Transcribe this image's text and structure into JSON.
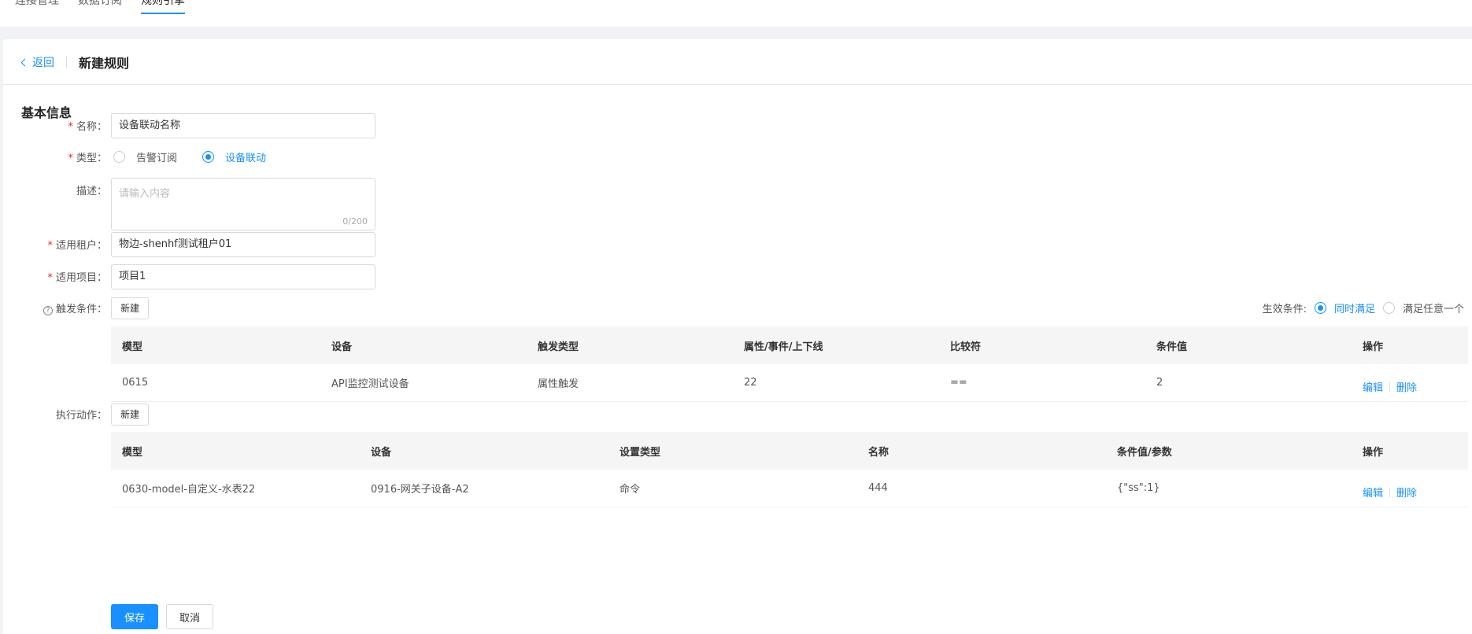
{
  "nav": {
    "tabs": [
      {
        "label": "连接管理",
        "active": false
      },
      {
        "label": "数据订阅",
        "active": false
      },
      {
        "label": "规则引擎",
        "active": true
      }
    ]
  },
  "header": {
    "back_label": "返回",
    "title": "新建规则"
  },
  "section": {
    "title": "基本信息"
  },
  "form": {
    "name": {
      "label": "名称：",
      "value": "设备联动名称"
    },
    "type": {
      "label": "类型：",
      "options": [
        {
          "label": "告警订阅",
          "checked": false
        },
        {
          "label": "设备联动",
          "checked": true
        }
      ]
    },
    "description": {
      "label": "描述：",
      "placeholder": "请输入内容",
      "count": "0/200"
    },
    "tenant": {
      "label": "适用租户：",
      "value": "物边-shenhf测试租户01"
    },
    "project": {
      "label": "适用项目：",
      "value": "项目1"
    }
  },
  "trigger": {
    "label": "触发条件：",
    "help_icon": "question-circle-icon",
    "new_label": "新建",
    "effect": {
      "label": "生效条件:",
      "options": [
        {
          "label": "同时满足",
          "checked": true
        },
        {
          "label": "满足任意一个",
          "checked": false
        }
      ]
    },
    "columns": [
      "模型",
      "设备",
      "触发类型",
      "属性/事件/上下线",
      "比较符",
      "条件值",
      "操作"
    ],
    "rows": [
      {
        "model": "0615",
        "device": "API监控测试设备",
        "trigger_type": "属性触发",
        "attr": "22",
        "op": "==",
        "value": "2",
        "edit": "编辑",
        "delete": "删除"
      }
    ]
  },
  "action": {
    "label": "执行动作：",
    "new_label": "新建",
    "columns": [
      "模型",
      "设备",
      "设置类型",
      "名称",
      "条件值/参数",
      "操作"
    ],
    "rows": [
      {
        "model": "0630-model-自定义-水表22",
        "device": "0916-网关子设备-A2",
        "set_type": "命令",
        "name": "444",
        "param": "{\"ss\":1}",
        "edit": "编辑",
        "delete": "删除"
      }
    ]
  },
  "footer": {
    "save_label": "保存",
    "cancel_label": "取消"
  },
  "colors": {
    "primary": "#1890ff",
    "required": "#f5222d"
  }
}
